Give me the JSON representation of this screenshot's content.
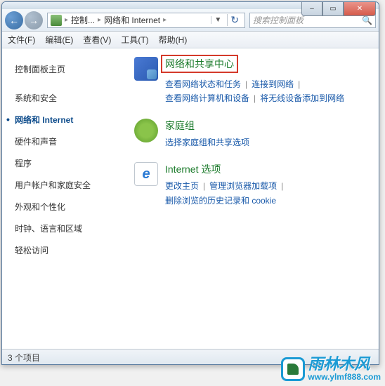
{
  "window": {
    "min_glyph": "–",
    "max_glyph": "▭",
    "close_glyph": "✕"
  },
  "nav": {
    "back_glyph": "←",
    "fwd_glyph": "→",
    "drop_glyph": "▼",
    "refresh_glyph": "↻"
  },
  "address": {
    "seg1": "控制...",
    "seg2": "网络和 Internet",
    "sep": "▸"
  },
  "search": {
    "placeholder": "搜索控制面板",
    "icon": "🔍"
  },
  "menu": {
    "file": "文件(F)",
    "edit": "编辑(E)",
    "view": "查看(V)",
    "tools": "工具(T)",
    "help": "帮助(H)"
  },
  "sidebar": {
    "items": [
      {
        "label": "控制面板主页",
        "active": false
      },
      {
        "label": "系统和安全",
        "active": false
      },
      {
        "label": "网络和 Internet",
        "active": true
      },
      {
        "label": "硬件和声音",
        "active": false
      },
      {
        "label": "程序",
        "active": false
      },
      {
        "label": "用户帐户和家庭安全",
        "active": false
      },
      {
        "label": "外观和个性化",
        "active": false
      },
      {
        "label": "时钟、语言和区域",
        "active": false
      },
      {
        "label": "轻松访问",
        "active": false
      }
    ]
  },
  "main": {
    "categories": [
      {
        "title": "网络和共享中心",
        "highlighted": true,
        "icon": "network",
        "links": [
          "查看网络状态和任务",
          "连接到网络",
          "查看网络计算机和设备",
          "将无线设备添加到网络"
        ]
      },
      {
        "title": "家庭组",
        "highlighted": false,
        "icon": "home",
        "links": [
          "选择家庭组和共享选项"
        ]
      },
      {
        "title": "Internet 选项",
        "highlighted": false,
        "icon": "ie",
        "links": [
          "更改主页",
          "管理浏览器加载项",
          "删除浏览的历史记录和 cookie"
        ]
      }
    ]
  },
  "status": {
    "text": "3 个项目"
  },
  "watermark": {
    "brand": "雨林木风",
    "url": "www.ylmf888.com"
  }
}
